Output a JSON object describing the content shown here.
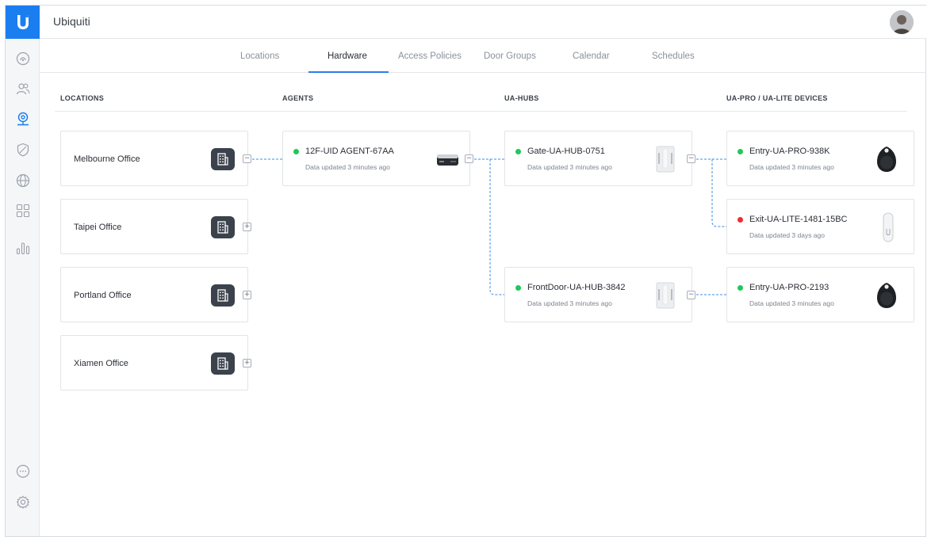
{
  "app": {
    "title": "Ubiquiti"
  },
  "tabs": [
    {
      "label": "Locations"
    },
    {
      "label": "Hardware"
    },
    {
      "label": "Access Policies"
    },
    {
      "label": "Door Groups"
    },
    {
      "label": "Calendar"
    },
    {
      "label": "Schedules"
    }
  ],
  "active_tab": "Hardware",
  "columns": {
    "locations": "LOCATIONS",
    "agents": "AGENTS",
    "hubs": "UA-HUBS",
    "devices": "UA-PRO / UA-LITE DEVICES"
  },
  "locations": [
    {
      "name": "Melbourne Office",
      "toggle": "−"
    },
    {
      "name": "Taipei Office",
      "toggle": "+"
    },
    {
      "name": "Portland Office",
      "toggle": "+"
    },
    {
      "name": "Xiamen Office",
      "toggle": "+"
    }
  ],
  "agents": [
    {
      "name": "12F-UID AGENT-67AA",
      "status": "Data updated 3 minutes ago",
      "toggle": "−",
      "state_color": "#1fc85a"
    }
  ],
  "hubs": [
    {
      "name": "Gate-UA-HUB-0751",
      "status": "Data updated 3 minutes ago",
      "toggle": "−",
      "state_color": "#1fc85a"
    },
    {
      "name": "FrontDoor-UA-HUB-3842",
      "status": "Data updated 3 minutes ago",
      "toggle": "−",
      "state_color": "#1fc85a"
    }
  ],
  "devices": [
    {
      "name": "Entry-UA-PRO-938K",
      "status": "Data updated 3 minutes ago",
      "state_color": "#1fc85a"
    },
    {
      "name": "Exit-UA-LITE-1481-15BC",
      "status": "Data updated 3 days ago",
      "state_color": "#ef2c33"
    },
    {
      "name": "Entry-UA-PRO-2193",
      "status": "Data updated 3 minutes ago",
      "state_color": "#1fc85a"
    }
  ],
  "colors": {
    "accent": "#1a7ef0",
    "online": "#1fc85a",
    "offline": "#ef2c33",
    "connector": "#3b8de6"
  },
  "sidebar_icons": [
    "dashboard-icon",
    "users-icon",
    "access-icon",
    "shield-icon",
    "globe-icon",
    "apps-icon",
    "stats-icon",
    "chat-icon",
    "settings-icon"
  ]
}
